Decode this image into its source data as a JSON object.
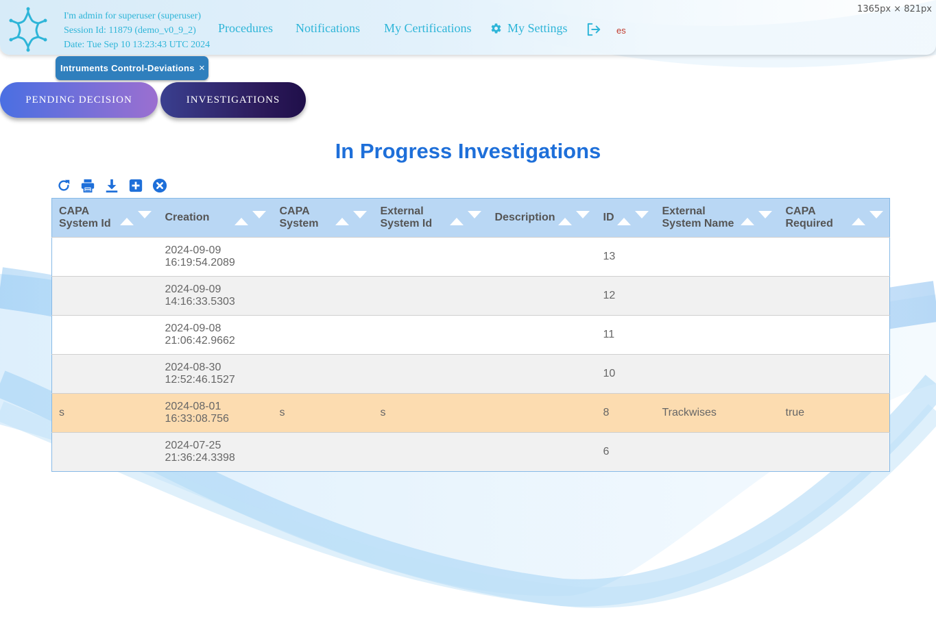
{
  "screen_size_label": "1365px × 821px",
  "session": {
    "user_line": "I'm admin for superuser (superuser)",
    "session_line": "Session Id: 11879 (demo_v0_9_2)",
    "date_line": "Date: Tue Sep 10 13:23:43 UTC 2024"
  },
  "nav": {
    "procedures": "Procedures",
    "notifications": "Notifications",
    "certifications": "My Certifications",
    "settings": "My Settings",
    "language": "es"
  },
  "open_tab": {
    "label": "Intruments Control-Deviations",
    "close": "×"
  },
  "buttons": {
    "pending": "PENDING DECISION",
    "investigations": "INVESTIGATIONS"
  },
  "title": "In Progress Investigations",
  "toolbar_icons": [
    "refresh-icon",
    "print-icon",
    "download-icon",
    "add-icon",
    "close-circle-icon"
  ],
  "table": {
    "headers": [
      [
        "CAPA",
        "System Id"
      ],
      [
        "Creation",
        ""
      ],
      [
        "CAPA",
        "System"
      ],
      [
        "External",
        "System Id"
      ],
      [
        "Description",
        ""
      ],
      [
        "ID",
        ""
      ],
      [
        "External",
        "System Name"
      ],
      [
        "CAPA",
        "Required"
      ]
    ],
    "rows": [
      {
        "style": "white",
        "cells": [
          "",
          "2024-09-09|16:19:54.2089",
          "",
          "",
          "",
          "13",
          "",
          ""
        ]
      },
      {
        "style": "grey",
        "cells": [
          "",
          "2024-09-09|14:16:33.5303",
          "",
          "",
          "",
          "12",
          "",
          ""
        ]
      },
      {
        "style": "white",
        "cells": [
          "",
          "2024-09-08|21:06:42.9662",
          "",
          "",
          "",
          "11",
          "",
          ""
        ]
      },
      {
        "style": "grey",
        "cells": [
          "",
          "2024-08-30|12:52:46.1527",
          "",
          "",
          "",
          "10",
          "",
          ""
        ]
      },
      {
        "style": "hl",
        "cells": [
          "s",
          "2024-08-01|16:33:08.756",
          "s",
          "s",
          "",
          "8",
          "Trackwises",
          "true"
        ]
      },
      {
        "style": "grey",
        "cells": [
          "",
          "2024-07-25|21:36:24.3398",
          "",
          "",
          "",
          "6",
          "",
          ""
        ]
      }
    ]
  },
  "colors": {
    "accent": "#1e6fd9",
    "nav_text": "#2eb5d8",
    "header_bg": "#b9d7f4",
    "highlight_row": "#fcdcb0"
  }
}
